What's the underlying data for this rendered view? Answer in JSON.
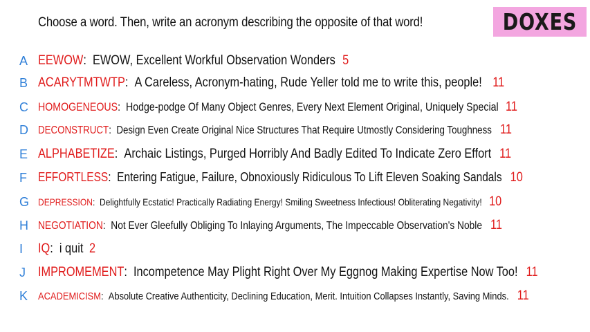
{
  "prompt": "Choose a word. Then, write an acronym describing the opposite of that word!",
  "logo": "DOXES",
  "rows": [
    {
      "letter": "A",
      "word": "EEWOW",
      "acronym": "EWOW, Excellent Workful Observation Wonders",
      "score": "5"
    },
    {
      "letter": "B",
      "word": "ACARYTMTWTP",
      "acronym": "A Careless, Acronym-hating, Rude Yeller told me to write this, people!",
      "score": "11"
    },
    {
      "letter": "C",
      "word": "HOMOGENEOUS",
      "acronym": "Hodge-podge Of Many Object Genres, Every Next Element Original, Uniquely Special",
      "score": "11"
    },
    {
      "letter": "D",
      "word": "DECONSTRUCT",
      "acronym": "Design Even Create Original Nice Structures That Require Utmostly Considering Toughness",
      "score": "11"
    },
    {
      "letter": "E",
      "word": "ALPHABETIZE",
      "acronym": "Archaic Listings, Purged Horribly And Badly Edited To Indicate Zero Effort",
      "score": "11"
    },
    {
      "letter": "F",
      "word": "EFFORTLESS",
      "acronym": "Entering Fatigue, Failure, Obnoxiously Ridiculous To Lift Eleven Soaking Sandals",
      "score": "10"
    },
    {
      "letter": "G",
      "word": "DEPRESSION",
      "acronym": "Delightfully Ecstatic! Practically Radiating Energy! Smiling Sweetness Infectious! Obliterating Negativity!",
      "score": "10"
    },
    {
      "letter": "H",
      "word": "NEGOTIATION",
      "acronym": "Not Ever Gleefully Obliging To Inlaying Arguments, The Impeccable Observation's Noble",
      "score": "11"
    },
    {
      "letter": "I",
      "word": "IQ",
      "acronym": "i quit",
      "score": "2"
    },
    {
      "letter": "J",
      "word": "IMPROMEMENT",
      "acronym": "Incompetence May Plight Right Over My Eggnog Making Expertise Now Too!",
      "score": "11"
    },
    {
      "letter": "K",
      "word": "ACADEMICISM",
      "acronym": "Absolute Creative Authenticity, Declining Education, Merit. Intuition Collapses Instantly, Saving Minds.",
      "score": "11"
    }
  ]
}
